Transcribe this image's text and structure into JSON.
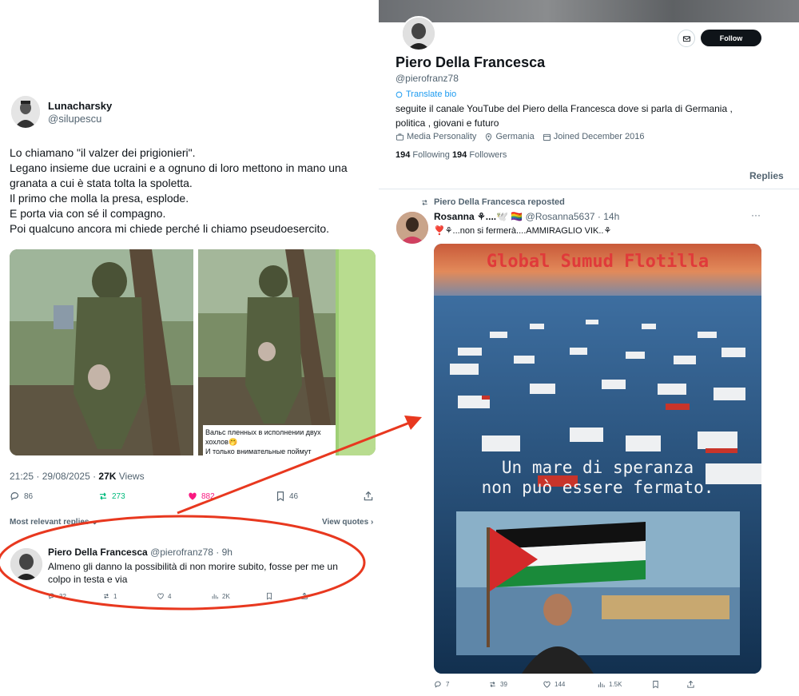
{
  "left_tweet": {
    "author_name": "Lunacharsky",
    "author_handle": "@silupescu",
    "text_lines": [
      "Lo chiamano \"il valzer dei prigionieri\".",
      "Legano insieme due ucraini e a ognuno di loro mettono in mano una",
      "granata a cui è stata tolta la spoletta.",
      "Il primo che molla la presa, esplode.",
      "E porta via con sé il compagno.",
      "Poi qualcuno ancora mi chiede perché li chiamo pseudoesercito."
    ],
    "photo_caption_lines": [
      "Вальс пленных в исполнении двух",
      "хохлов🤭",
      "И только внимательные поймут"
    ],
    "time": "21:25 · 29/08/2025 · ",
    "views_count": "27K",
    "views_label": " Views",
    "stats": {
      "replies": "86",
      "reposts": "273",
      "likes": "882",
      "bookmarks": "46"
    },
    "sort_label": "Most relevant replies ⌄",
    "view_quotes": "View quotes ›"
  },
  "reply": {
    "author_name": "Piero Della Francesca",
    "author_meta": " @pierofranz78 · 9h",
    "text_lines": [
      "Almeno gli danno la possibilità di non morire subito, fosse per me un",
      "colpo in testa e via"
    ],
    "stats": {
      "replies": "32",
      "reposts": "1",
      "likes": "4",
      "views": "2K"
    }
  },
  "profile": {
    "follow_label": "Follow",
    "name": "Piero Della Francesca",
    "handle": "@pierofranz78",
    "translate": "Translate bio",
    "bio_lines": [
      "seguite il canale YouTube del Piero della Francesca dove si parla di Germania ,",
      "politica , giovani e futuro"
    ],
    "category": "Media Personality",
    "location": "Germania",
    "joined": "Joined December 2016",
    "following_count": "194",
    "following_label": " Following ",
    "followers_count": "194",
    "followers_label": " Followers",
    "tab": "Replies"
  },
  "repost": {
    "reposted_label": "Piero Della Francesca reposted",
    "author_name": "Rosanna ⚘....🕊️ 🏳️‍🌈",
    "author_meta": " @Rosanna5637 · 14h",
    "text": "❣️⚘...non si fermerà....AMMIRAGLIO VIK..⚘",
    "image_title": "Global Sumud Flotilla",
    "image_slogan_lines": [
      "Un mare di speranza",
      "non può essere fermato."
    ],
    "stats": {
      "replies": "7",
      "reposts": "39",
      "likes": "144",
      "views": "1.5K"
    }
  },
  "colors": {
    "accent": "#1d9bf0",
    "like_pink": "#f91880",
    "repost_green": "#00ba7c",
    "annotation_red": "#e8381f"
  }
}
